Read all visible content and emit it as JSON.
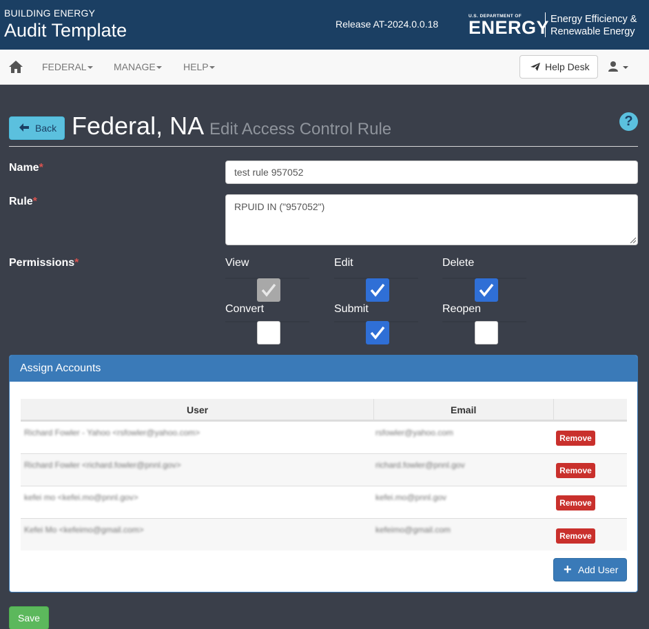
{
  "header": {
    "brand_small": "BUILDING ENERGY",
    "brand_big": "Audit Template",
    "release": "Release AT-2024.0.0.18",
    "doe_small": "U.S. DEPARTMENT OF",
    "doe_big": "ENERGY",
    "eere_line1": "Energy Efficiency &",
    "eere_line2": "Renewable Energy"
  },
  "nav": {
    "items": [
      {
        "label": "FEDERAL"
      },
      {
        "label": "MANAGE"
      },
      {
        "label": "HELP"
      }
    ],
    "help_desk": "Help Desk",
    "icons": {
      "home": "home-icon",
      "user": "user-icon",
      "help_desk": "paper-plane-icon"
    }
  },
  "page": {
    "back_label": "Back",
    "title": "Federal, NA",
    "subtitle": "Edit Access Control Rule",
    "help_icon_glyph": "?"
  },
  "form": {
    "name_label": "Name",
    "name_value": "test rule 957052",
    "rule_label": "Rule",
    "rule_value": "RPUID IN (\"957052\")",
    "required_mark": "*",
    "permissions_label": "Permissions",
    "permissions": [
      {
        "label": "View",
        "checked": true,
        "disabled": true
      },
      {
        "label": "Edit",
        "checked": true,
        "disabled": false
      },
      {
        "label": "Delete",
        "checked": true,
        "disabled": false
      },
      {
        "label": "Convert",
        "checked": false,
        "disabled": false
      },
      {
        "label": "Submit",
        "checked": true,
        "disabled": false
      },
      {
        "label": "Reopen",
        "checked": false,
        "disabled": false
      }
    ]
  },
  "accounts": {
    "panel_title": "Assign Accounts",
    "columns": [
      "User",
      "Email",
      ""
    ],
    "rows": [
      {
        "user": "Richard Fowler - Yahoo <rsfowler@yahoo.com>",
        "email": "rsfowler@yahoo.com",
        "action": "Remove"
      },
      {
        "user": "Richard Fowler <richard.fowler@pnnl.gov>",
        "email": "richard.fowler@pnnl.gov",
        "action": "Remove"
      },
      {
        "user": "kefei mo <kefei.mo@pnnl.gov>",
        "email": "kefei.mo@pnnl.gov",
        "action": "Remove"
      },
      {
        "user": "Kefei Mo <kefeimo@gmail.com>",
        "email": "kefeimo@gmail.com",
        "action": "Remove"
      }
    ],
    "add_user": "Add User"
  },
  "save_label": "Save",
  "colors": {
    "header_bg": "#1b3f63",
    "page_bg": "#3a3f4a",
    "panel_accent": "#3a7ab8",
    "remove": "#c9302c",
    "save": "#5cb85c",
    "checkbox_on": "#2f6fd6"
  }
}
